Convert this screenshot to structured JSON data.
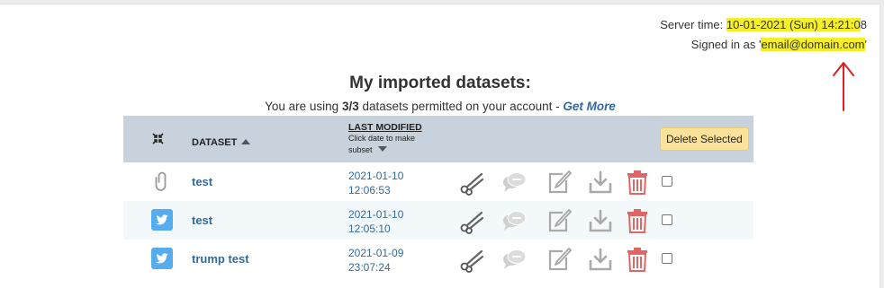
{
  "server": {
    "time_prefix": "Server time: ",
    "time_highlighted": "10-01-2021 (Sun) 14:21:0",
    "time_tail": "8",
    "signed_prefix": "Signed in as '",
    "email": "email@domain.com",
    "signed_suffix": "'"
  },
  "heading": "My imported datasets:",
  "usage": {
    "before": "You are using ",
    "count": "3/3",
    "after": " datasets permitted on your account - ",
    "link": "Get More"
  },
  "table": {
    "col_dataset": "DATASET",
    "col_modified": "LAST MODIFIED",
    "col_modified_hint": "Click date to make subset",
    "delete_label": "Delete Selected",
    "rows": [
      {
        "source_icon": "paperclip-icon",
        "name": "test",
        "date": "2021-01-10",
        "time": "12:06:53"
      },
      {
        "source_icon": "twitter-icon",
        "name": "test",
        "date": "2021-01-10",
        "time": "12:05:10"
      },
      {
        "source_icon": "twitter-icon",
        "name": "trump test",
        "date": "2021-01-09",
        "time": "23:07:24"
      }
    ]
  },
  "colors": {
    "header_bg": "#c8d2dc",
    "link": "#336a9c",
    "highlight": "#f5ef27",
    "delete_button": "#fbe29a",
    "trash": "#e06666",
    "twitter": "#55acee",
    "annotation_arrow": "#e02020"
  }
}
